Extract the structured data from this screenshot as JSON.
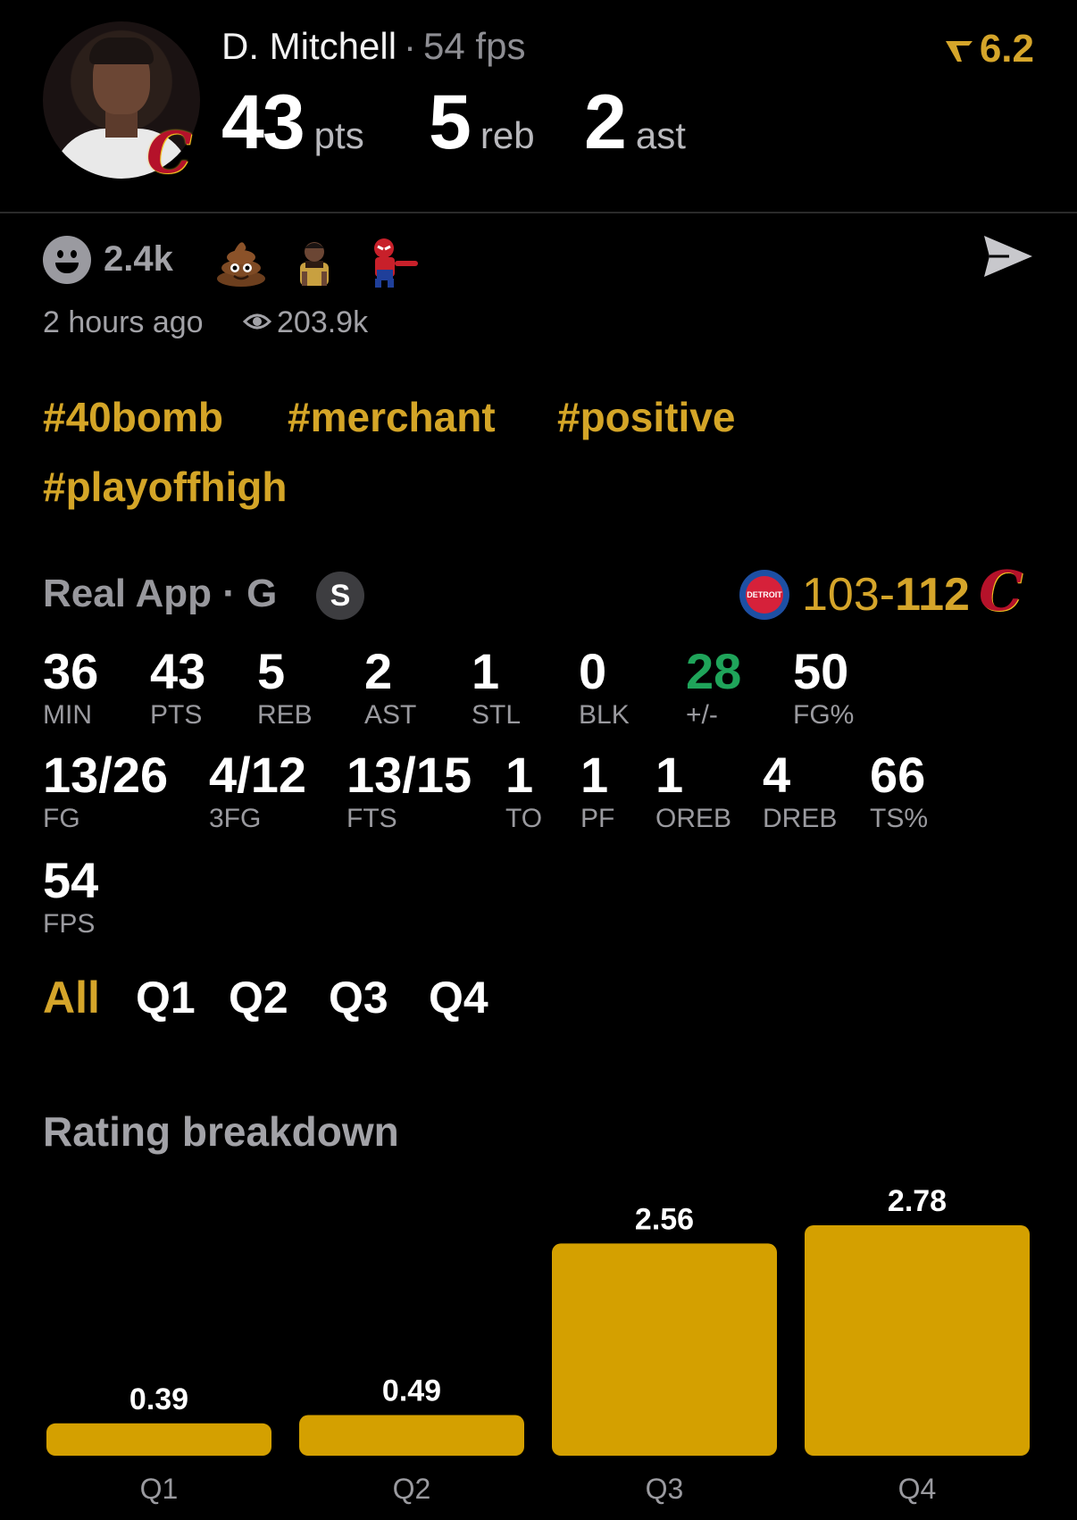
{
  "header": {
    "player_name": "D. Mitchell",
    "separator": "·",
    "fps": "54 fps",
    "rating": "6.2",
    "stats": [
      {
        "value": "43",
        "unit": "pts"
      },
      {
        "value": "5",
        "unit": "reb"
      },
      {
        "value": "2",
        "unit": "ast"
      }
    ]
  },
  "reactions": {
    "count": "2.4k",
    "emojis": [
      "poop-emoji",
      "player-sticker",
      "spiderman-pointing-sticker"
    ]
  },
  "meta": {
    "time_ago": "2 hours ago",
    "views": "203.9k"
  },
  "hashtags": [
    "#40bomb",
    "#merchant",
    "#positive",
    "#playoffhigh"
  ],
  "game": {
    "source": "Real App · G",
    "badge": "S",
    "score_left": "103-",
    "score_right": "112",
    "away_team": "Detroit Pistons",
    "home_team": "Cleveland Cavaliers"
  },
  "box_score": {
    "row1": [
      {
        "value": "36",
        "label": "MIN"
      },
      {
        "value": "43",
        "label": "PTS"
      },
      {
        "value": "5",
        "label": "REB"
      },
      {
        "value": "2",
        "label": "AST"
      },
      {
        "value": "1",
        "label": "STL"
      },
      {
        "value": "0",
        "label": "BLK"
      },
      {
        "value": "28",
        "label": "+/-",
        "color": "#1fa45a"
      },
      {
        "value": "50",
        "label": "FG%"
      }
    ],
    "row2": [
      {
        "value": "13/26",
        "label": "FG"
      },
      {
        "value": "4/12",
        "label": "3FG"
      },
      {
        "value": "13/15",
        "label": "FTS"
      },
      {
        "value": "1",
        "label": "TO"
      },
      {
        "value": "1",
        "label": "PF"
      },
      {
        "value": "1",
        "label": "OREB"
      },
      {
        "value": "4",
        "label": "DREB"
      },
      {
        "value": "66",
        "label": "TS%"
      }
    ],
    "row3": [
      {
        "value": "54",
        "label": "FPS"
      }
    ]
  },
  "tabs": [
    {
      "label": "All",
      "active": true
    },
    {
      "label": "Q1",
      "active": false
    },
    {
      "label": "Q2",
      "active": false
    },
    {
      "label": "Q3",
      "active": false
    },
    {
      "label": "Q4",
      "active": false
    }
  ],
  "breakdown_title": "Rating breakdown",
  "colors": {
    "accent": "#d5a52a",
    "bar": "#d4a000",
    "positive": "#1fa45a",
    "muted": "#9a9a9f"
  },
  "chart_data": {
    "type": "bar",
    "categories": [
      "Q1",
      "Q2",
      "Q3",
      "Q4"
    ],
    "values": [
      0.39,
      0.49,
      2.56,
      2.78
    ],
    "value_labels": [
      "0.39",
      "0.49",
      "2.56",
      "2.78"
    ],
    "title": "Rating breakdown",
    "ylim": [
      0,
      2.78
    ],
    "grid": false
  }
}
